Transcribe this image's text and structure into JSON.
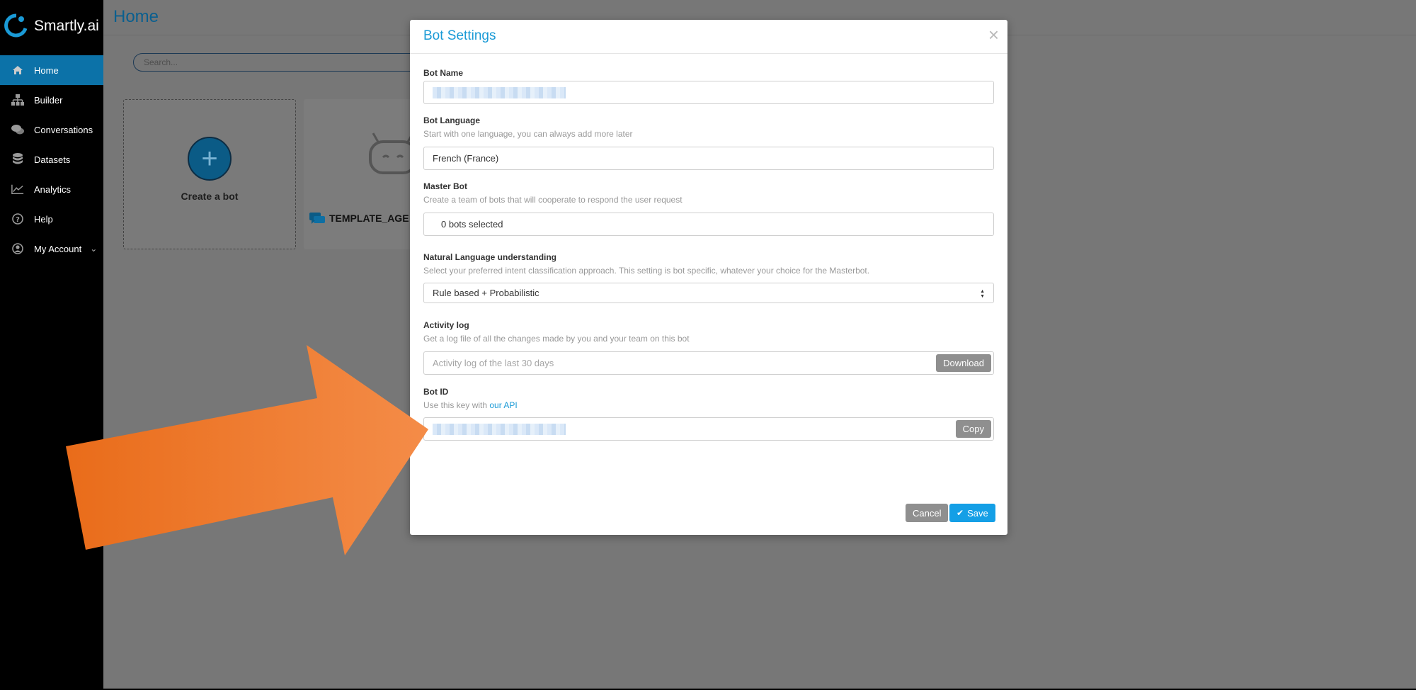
{
  "app": {
    "name": "Smartly.ai",
    "page_title": "Home"
  },
  "sidebar": {
    "items": [
      {
        "label": "Home",
        "icon": "home-icon",
        "active": true
      },
      {
        "label": "Builder",
        "icon": "sitemap-icon"
      },
      {
        "label": "Conversations",
        "icon": "chat-icon"
      },
      {
        "label": "Datasets",
        "icon": "database-icon"
      },
      {
        "label": "Analytics",
        "icon": "line-chart-icon"
      },
      {
        "label": "Help",
        "icon": "help-icon"
      },
      {
        "label": "My Account",
        "icon": "user-icon",
        "has_chevron": true
      }
    ]
  },
  "main": {
    "search_placeholder": "Search...",
    "create_bot_label": "Create a bot",
    "bot_card_name": "TEMPLATE_AGE"
  },
  "modal": {
    "title": "Bot Settings",
    "bot_name": {
      "label": "Bot Name",
      "value_redacted": true
    },
    "bot_language": {
      "label": "Bot Language",
      "help": "Start with one language, you can always add more later",
      "value": "French (France)"
    },
    "master_bot": {
      "label": "Master Bot",
      "help": "Create a team of bots that will cooperate to respond the user request",
      "value": "0 bots selected"
    },
    "nlu": {
      "label": "Natural Language understanding",
      "help": "Select your preferred intent classification approach. This setting is bot specific, whatever your choice for the Masterbot.",
      "value": "Rule based + Probabilistic"
    },
    "activity_log": {
      "label": "Activity log",
      "help": "Get a log file of all the changes made by you and your team on this bot",
      "placeholder": "Activity log of the last 30 days",
      "button": "Download"
    },
    "bot_id": {
      "label": "Bot ID",
      "help_prefix": "Use this key with",
      "help_link": "our API",
      "value_redacted": true,
      "button": "Copy"
    },
    "cancel_label": "Cancel",
    "save_label": "Save"
  },
  "colors": {
    "accent": "#1a9ad6",
    "save_button": "#149fe6",
    "sidebar_active": "#0c72a8",
    "arrow": "#f07e2e"
  }
}
